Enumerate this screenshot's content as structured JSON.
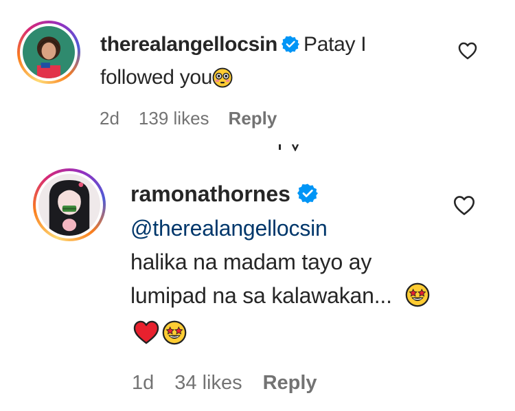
{
  "comments": [
    {
      "username": "therealangellocsin",
      "verified": true,
      "text": "Patay I followed you",
      "emoji": "flushed-face",
      "time": "2d",
      "likes": "139 likes",
      "reply_label": "Reply"
    },
    {
      "username": "ramonathornes",
      "verified": true,
      "mention": "@therealangellocsin",
      "text": "halika na madam tayo ay lumipad na sa kalawakan...",
      "emojis": [
        "star-struck-face",
        "red-heart",
        "star-struck-face"
      ],
      "time": "1d",
      "likes": "34 likes",
      "reply_label": "Reply"
    }
  ],
  "colors": {
    "verified": "#0095f6",
    "mention": "#00376b",
    "meta": "#737373",
    "text": "#262626"
  }
}
